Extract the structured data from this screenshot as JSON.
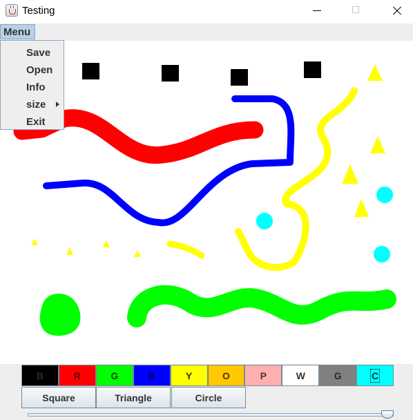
{
  "window": {
    "title": "Testing"
  },
  "menubar": {
    "menu_label": "Menu"
  },
  "menu": {
    "items": [
      {
        "label": "Save"
      },
      {
        "label": "Open"
      },
      {
        "label": "Info"
      },
      {
        "label": "size",
        "has_submenu": true
      },
      {
        "label": "Exit"
      }
    ]
  },
  "palette": {
    "buttons": [
      {
        "label": "B",
        "bg": "#000000",
        "fg": "#2a2a2a"
      },
      {
        "label": "R",
        "bg": "#ff0000",
        "fg": "#5a0000"
      },
      {
        "label": "G",
        "bg": "#00ff00",
        "fg": "#004400"
      },
      {
        "label": "B",
        "bg": "#0000ff",
        "fg": "#000055"
      },
      {
        "label": "Y",
        "bg": "#ffff00",
        "fg": "#333300"
      },
      {
        "label": "O",
        "bg": "#ffc800",
        "fg": "#553300"
      },
      {
        "label": "P",
        "bg": "#ffafaf",
        "fg": "#553333"
      },
      {
        "label": "W",
        "bg": "#ffffff",
        "fg": "#333333"
      },
      {
        "label": "G",
        "bg": "#808080",
        "fg": "#2a2a2a"
      },
      {
        "label": "C",
        "bg": "#00ffff",
        "fg": "#003333",
        "selected": true
      }
    ]
  },
  "shapes": {
    "buttons": [
      {
        "label": "Square"
      },
      {
        "label": "Triangle"
      },
      {
        "label": "Circle"
      }
    ]
  },
  "size_slider": {
    "value_fraction": 1.0
  },
  "drawing": {
    "colors": {
      "black": "#000000",
      "red": "#ff0000",
      "blue": "#0000ff",
      "yellow": "#ffff00",
      "cyan": "#00ffff",
      "green": "#00ff00"
    }
  }
}
